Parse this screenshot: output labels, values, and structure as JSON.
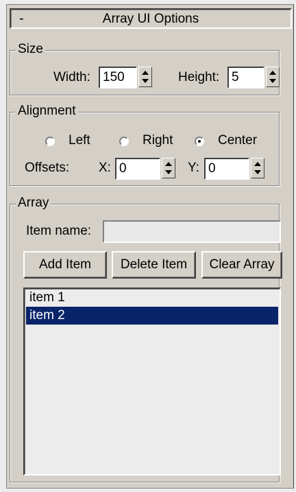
{
  "rollout": {
    "collapse_symbol": "-",
    "title": "Array UI Options"
  },
  "size_group": {
    "title": "Size",
    "width_label": "Width:",
    "width_value": "150",
    "height_label": "Height:",
    "height_value": "5"
  },
  "alignment_group": {
    "title": "Alignment",
    "options": [
      {
        "label": "Left",
        "selected": false
      },
      {
        "label": "Right",
        "selected": false
      },
      {
        "label": "Center",
        "selected": true
      }
    ],
    "offsets_label": "Offsets:",
    "x_label": "X:",
    "x_value": "0",
    "y_label": "Y:",
    "y_value": "0"
  },
  "array_group": {
    "title": "Array",
    "item_name_label": "Item name:",
    "item_name_value": "",
    "add_label": "Add Item",
    "delete_label": "Delete Item",
    "clear_label": "Clear Array",
    "items": [
      {
        "label": "item 1",
        "selected": false
      },
      {
        "label": "item 2",
        "selected": true
      }
    ]
  },
  "colors": {
    "panel": "#d4d0c8",
    "selection": "#0a246a"
  }
}
